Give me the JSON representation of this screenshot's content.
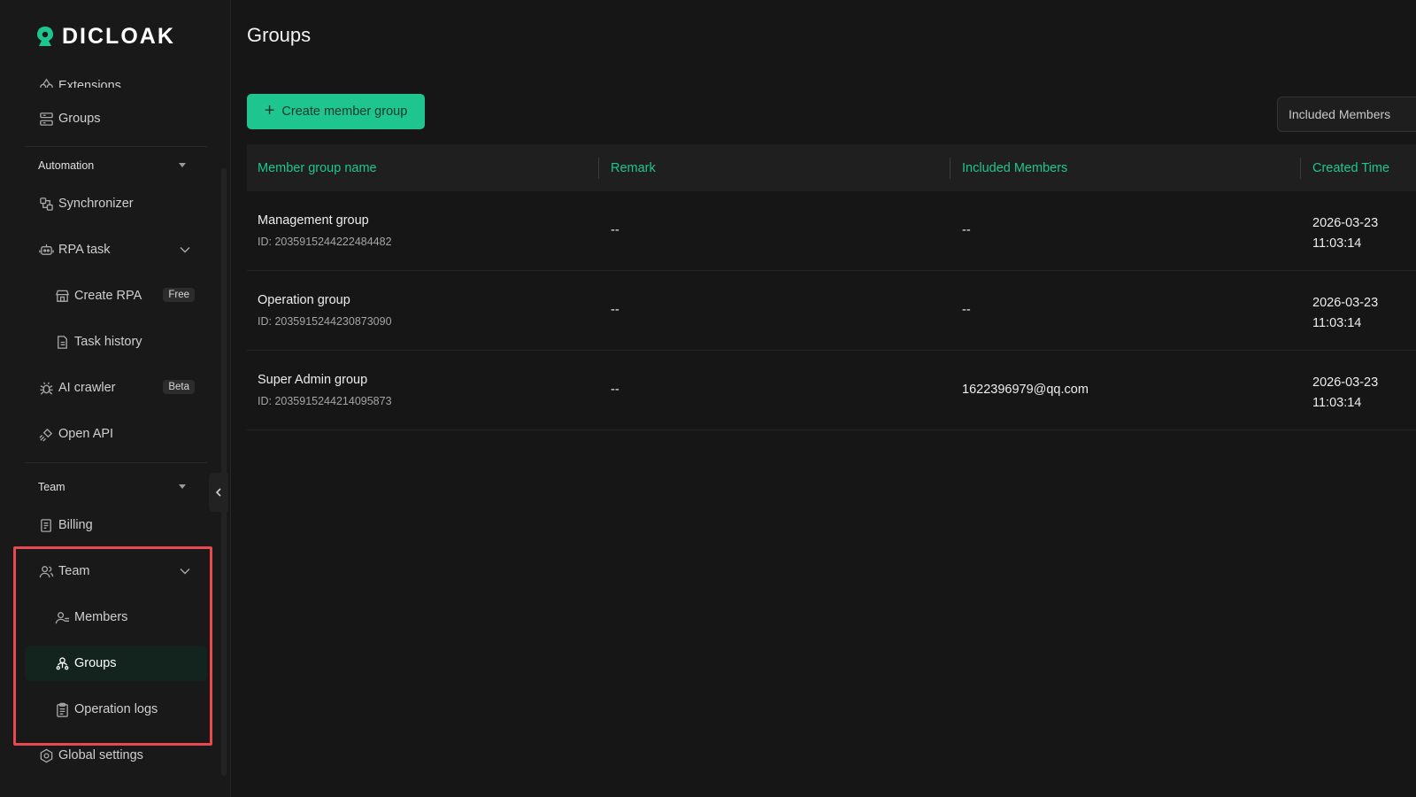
{
  "brand": {
    "name": "DICLOAK",
    "accent": "#1fc58f"
  },
  "sidebar": {
    "top_items": [
      {
        "label": "Extensions",
        "icon": "extensions-icon"
      },
      {
        "label": "Groups",
        "icon": "groups-icon"
      }
    ],
    "automation": {
      "header": "Automation",
      "items": [
        {
          "label": "Synchronizer",
          "icon": "synchronizer-icon"
        },
        {
          "label": "RPA task",
          "icon": "robot-icon"
        },
        {
          "label": "Create RPA",
          "icon": "store-icon",
          "badge": "Free"
        },
        {
          "label": "Task history",
          "icon": "document-icon"
        },
        {
          "label": "AI crawler",
          "icon": "spider-icon",
          "badge": "Beta"
        },
        {
          "label": "Open API",
          "icon": "api-icon"
        }
      ]
    },
    "team": {
      "header": "Team",
      "items": [
        {
          "label": "Billing",
          "icon": "billing-icon"
        },
        {
          "label": "Team",
          "icon": "team-icon"
        },
        {
          "label": "Members",
          "icon": "members-icon"
        },
        {
          "label": "Groups",
          "icon": "groups-icon",
          "active": true
        },
        {
          "label": "Operation logs",
          "icon": "clipboard-icon"
        },
        {
          "label": "Global settings",
          "icon": "settings-icon"
        }
      ]
    }
  },
  "main": {
    "title": "Groups",
    "create_button": "Create member group",
    "filter": {
      "selected": "Included Members"
    },
    "table": {
      "headers": [
        "Member group name",
        "Remark",
        "Included Members",
        "Created Time"
      ],
      "rows": [
        {
          "name": "Management group",
          "id": "ID: 2035915244222484482",
          "remark": "--",
          "members": "--",
          "date": "2026-03-23",
          "time": "11:03:14"
        },
        {
          "name": "Operation group",
          "id": "ID: 2035915244230873090",
          "remark": "--",
          "members": "--",
          "date": "2026-03-23",
          "time": "11:03:14"
        },
        {
          "name": "Super Admin group",
          "id": "ID: 2035915244214095873",
          "remark": "--",
          "members": "1622396979@qq.com",
          "date": "2026-03-23",
          "time": "11:03:14"
        }
      ]
    }
  }
}
